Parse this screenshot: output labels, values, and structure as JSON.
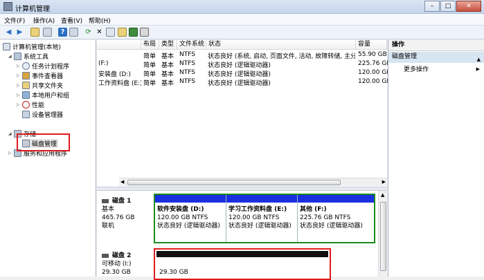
{
  "window": {
    "title": "计算机管理"
  },
  "menu": [
    "文件(F)",
    "操作(A)",
    "查看(V)",
    "帮助(H)"
  ],
  "tree": {
    "root": "计算机管理(本地)",
    "system_tools": "系统工具",
    "task_scheduler": "任务计划程序",
    "event_viewer": "事件查看器",
    "shared_folders": "共享文件夹",
    "local_users": "本地用户和组",
    "performance": "性能",
    "device_manager": "设备管理器",
    "storage": "存储",
    "disk_management": "磁盘管理",
    "services_apps": "服务和应用程序"
  },
  "volume_table": {
    "headers": [
      "布局",
      "类型",
      "文件系统",
      "状态",
      "容量"
    ],
    "rows": [
      {
        "name": "",
        "layout": "简单",
        "type": "基本",
        "fs": "NTFS",
        "status": "状态良好 (系统, 启动, 页面文件, 活动, 故障转储, 主分区)",
        "capacity": "55.90 GB"
      },
      {
        "name": "(F:)",
        "layout": "简单",
        "type": "基本",
        "fs": "NTFS",
        "status": "状态良好 (逻辑驱动器)",
        "capacity": "225.76 GB"
      },
      {
        "name": "安装盘 (D:)",
        "layout": "简单",
        "type": "基本",
        "fs": "NTFS",
        "status": "状态良好 (逻辑驱动器)",
        "capacity": "120.00 GB"
      },
      {
        "name": "工作资料盘 (E:)",
        "layout": "简单",
        "type": "基本",
        "fs": "NTFS",
        "status": "状态良好 (逻辑驱动器)",
        "capacity": "120.00 GB"
      }
    ]
  },
  "disk1": {
    "name": "磁盘 1",
    "kind": "基本",
    "size": "465.76 GB",
    "state": "联机",
    "partitions": [
      {
        "label": "软件安装盘  (D:)",
        "detail": "120.00 GB NTFS",
        "status": "状态良好 (逻辑驱动器)"
      },
      {
        "label": "学习工作资料盘  (E:)",
        "detail": "120.00 GB NTFS",
        "status": "状态良好 (逻辑驱动器)"
      },
      {
        "label": "其他  (F:)",
        "detail": "225.76 GB NTFS",
        "status": "状态良好 (逻辑驱动器)"
      }
    ]
  },
  "disk2": {
    "name": "磁盘 2",
    "kind": "可移动 (I:)",
    "size": "29.30 GB",
    "part_size": "29.30 GB"
  },
  "actions_panel": {
    "header": "操作",
    "section": "磁盘管理",
    "more": "更多操作"
  }
}
